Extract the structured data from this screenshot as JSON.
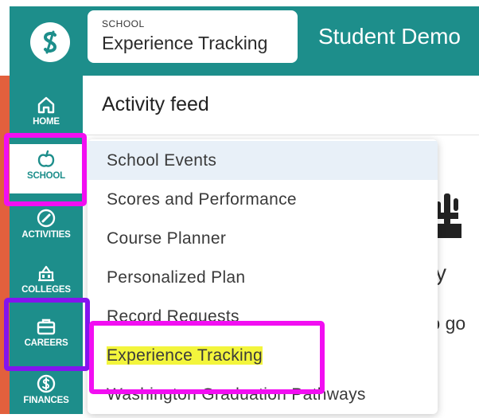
{
  "header": {
    "context_label": "SCHOOL",
    "context_title": "Experience Tracking",
    "student_name": "Student Demo"
  },
  "sidebar": {
    "items": [
      {
        "label": "HOME",
        "icon": "home-icon"
      },
      {
        "label": "SCHOOL",
        "icon": "apple-icon"
      },
      {
        "label": "ACTIVITIES",
        "icon": "pencil-icon"
      },
      {
        "label": "COLLEGES",
        "icon": "building-icon"
      },
      {
        "label": "CAREERS",
        "icon": "briefcase-icon"
      },
      {
        "label": "FINANCES",
        "icon": "dollar-icon"
      }
    ]
  },
  "main": {
    "feed_title": "Activity feed",
    "background_heading": "vity",
    "background_text": "to go"
  },
  "dropdown": {
    "items": [
      {
        "label": "School Events"
      },
      {
        "label": "Scores and Performance"
      },
      {
        "label": "Course Planner"
      },
      {
        "label": "Personalized Plan"
      },
      {
        "label": "Record Requests"
      },
      {
        "label": "Experience Tracking"
      },
      {
        "label": "Washington Graduation Pathways"
      }
    ]
  },
  "colors": {
    "brand_teal": "#1d8e8b",
    "highlight_magenta": "#f20ef2",
    "highlight_purple": "#8414ee",
    "highlight_yellow": "#f3f53c",
    "accent_orange": "#e2603d"
  }
}
